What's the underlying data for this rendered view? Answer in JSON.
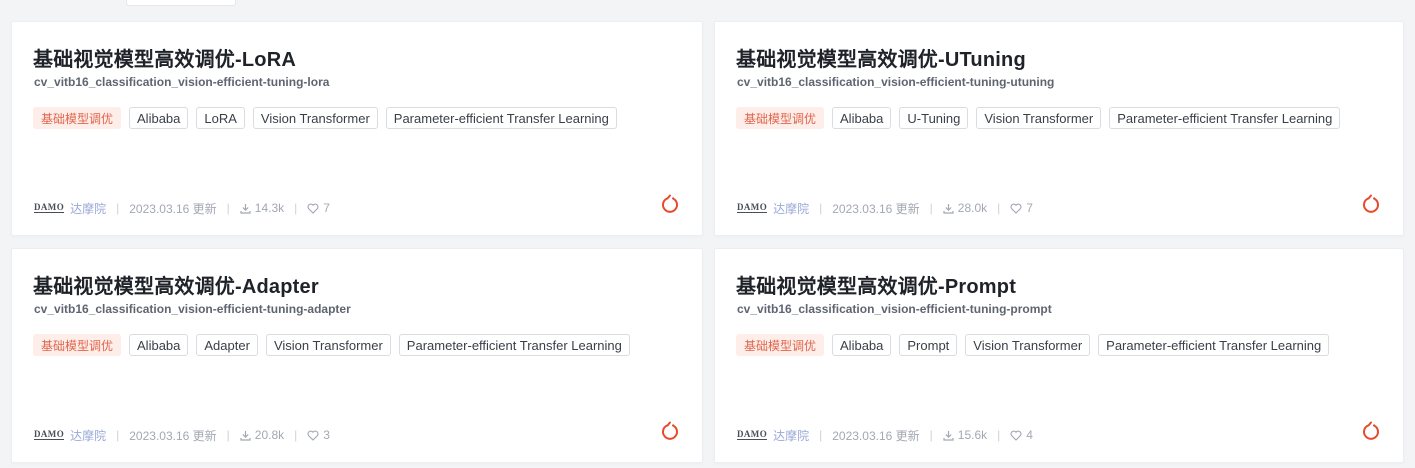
{
  "theme": {
    "accent": "#e8492b",
    "tag_primary_bg": "#fdeeea",
    "tag_primary_text": "#e0654a",
    "org_color": "#9aa8d8"
  },
  "cards": [
    {
      "title": "基础视觉模型高效调优-LoRA",
      "slug": "cv_vitb16_classification_vision-efficient-tuning-lora",
      "tags": [
        "基础模型调优",
        "Alibaba",
        "LoRA",
        "Vision Transformer",
        "Parameter-efficient Transfer Learning"
      ],
      "logo": "DAMO",
      "org": "达摩院",
      "date": "2023.03.16 更新",
      "downloads": "14.3k",
      "likes": "7"
    },
    {
      "title": "基础视觉模型高效调优-UTuning",
      "slug": "cv_vitb16_classification_vision-efficient-tuning-utuning",
      "tags": [
        "基础模型调优",
        "Alibaba",
        "U-Tuning",
        "Vision Transformer",
        "Parameter-efficient Transfer Learning"
      ],
      "logo": "DAMO",
      "org": "达摩院",
      "date": "2023.03.16 更新",
      "downloads": "28.0k",
      "likes": "7"
    },
    {
      "title": "基础视觉模型高效调优-Adapter",
      "slug": "cv_vitb16_classification_vision-efficient-tuning-adapter",
      "tags": [
        "基础模型调优",
        "Alibaba",
        "Adapter",
        "Vision Transformer",
        "Parameter-efficient Transfer Learning"
      ],
      "logo": "DAMO",
      "org": "达摩院",
      "date": "2023.03.16 更新",
      "downloads": "20.8k",
      "likes": "3"
    },
    {
      "title": "基础视觉模型高效调优-Prompt",
      "slug": "cv_vitb16_classification_vision-efficient-tuning-prompt",
      "tags": [
        "基础模型调优",
        "Alibaba",
        "Prompt",
        "Vision Transformer",
        "Parameter-efficient Transfer Learning"
      ],
      "logo": "DAMO",
      "org": "达摩院",
      "date": "2023.03.16 更新",
      "downloads": "15.6k",
      "likes": "4"
    }
  ]
}
